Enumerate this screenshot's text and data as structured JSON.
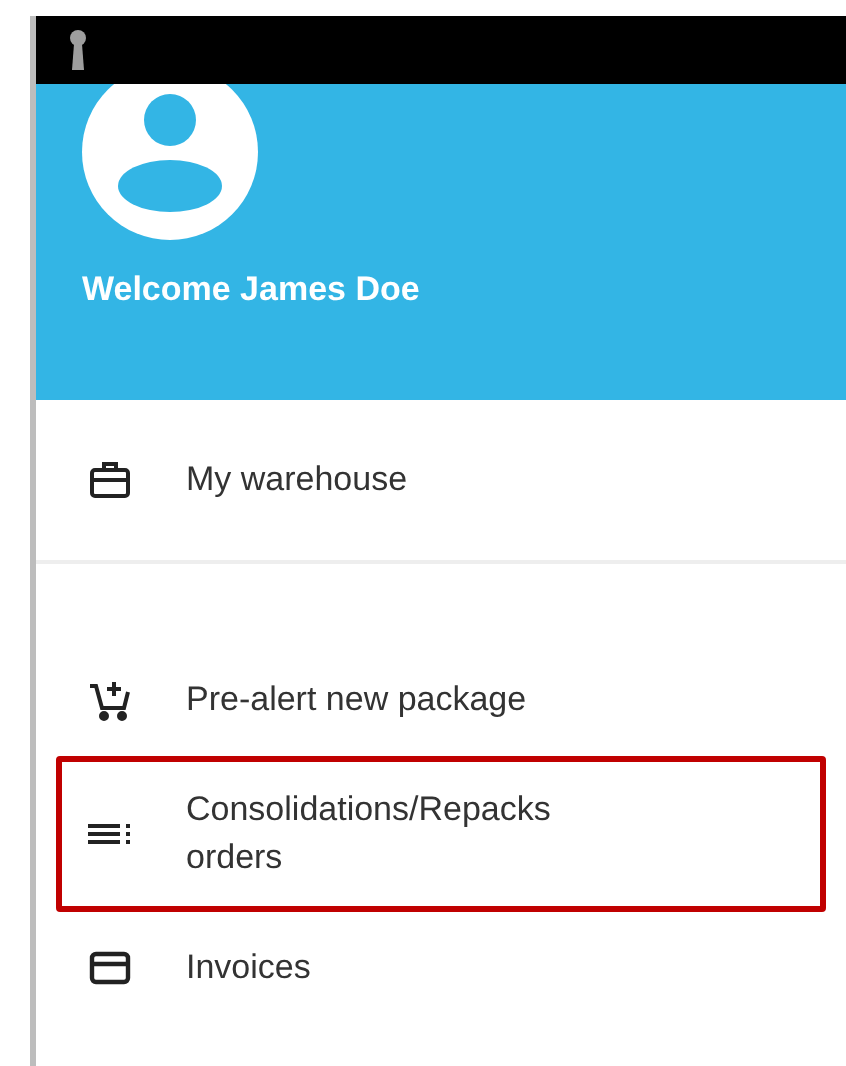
{
  "header": {
    "welcome": "Welcome James Doe"
  },
  "sections": [
    {
      "items": [
        {
          "kind": "warehouse",
          "label": "My warehouse",
          "highlighted": false
        }
      ]
    },
    {
      "items": [
        {
          "kind": "prealert",
          "label": "Pre-alert new package",
          "highlighted": false
        },
        {
          "kind": "orders",
          "label": "Consolidations/Repacks orders",
          "highlighted": true
        },
        {
          "kind": "invoices",
          "label": "Invoices",
          "highlighted": false
        }
      ]
    }
  ]
}
